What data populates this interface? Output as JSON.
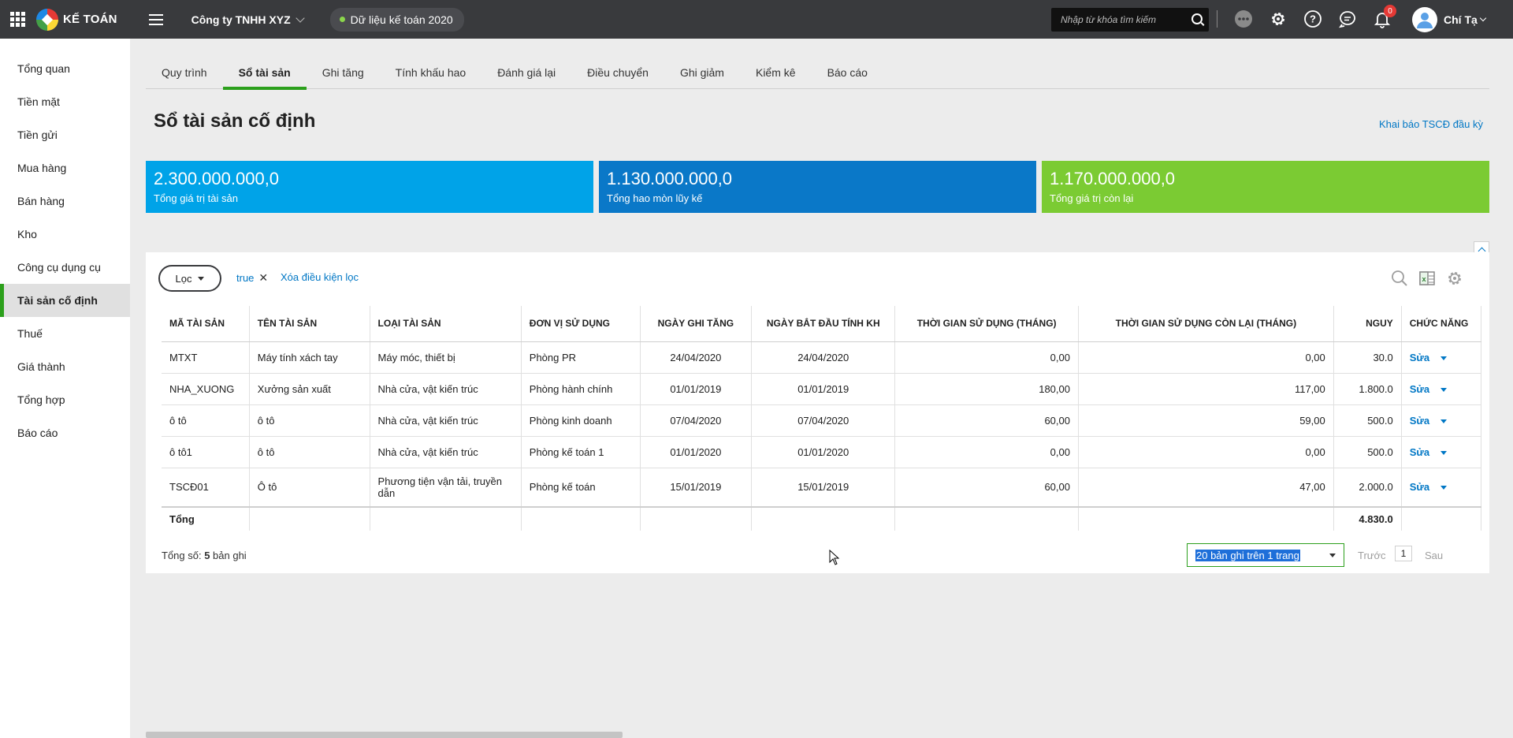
{
  "header": {
    "app_name": "KẾ TOÁN",
    "company": "Công ty TNHH XYZ",
    "dataset": "Dữ liệu kế toán 2020",
    "search_placeholder": "Nhập từ khóa tìm kiếm",
    "notification_count": "0",
    "user_name": "Chí Tạ"
  },
  "sidebar": {
    "items": [
      {
        "label": "Tổng quan"
      },
      {
        "label": "Tiền mặt"
      },
      {
        "label": "Tiền gửi"
      },
      {
        "label": "Mua hàng"
      },
      {
        "label": "Bán hàng"
      },
      {
        "label": "Kho"
      },
      {
        "label": "Công cụ dụng cụ"
      },
      {
        "label": "Tài sản cố định",
        "active": true
      },
      {
        "label": "Thuế"
      },
      {
        "label": "Giá thành"
      },
      {
        "label": "Tổng hợp"
      },
      {
        "label": "Báo cáo"
      }
    ]
  },
  "tabs": [
    "Quy trình",
    "Sổ tài sản",
    "Ghi tăng",
    "Tính khấu hao",
    "Đánh giá lại",
    "Điều chuyển",
    "Ghi giảm",
    "Kiểm kê",
    "Báo cáo"
  ],
  "active_tab": "Sổ tài sản",
  "page": {
    "title": "Sổ tài sản cố định",
    "declare_link": "Khai báo TSCĐ đầu kỳ"
  },
  "kpis": [
    {
      "value": "2.300.000.000,0",
      "label": "Tổng giá trị tài sản",
      "color": "#00a3e8"
    },
    {
      "value": "1.130.000.000,0",
      "label": "Tổng hao mòn lũy kế",
      "color": "#0a78c8"
    },
    {
      "value": "1.170.000.000,0",
      "label": "Tổng giá trị còn lại",
      "color": "#7bcb33"
    }
  ],
  "filter": {
    "button_label": "Lọc",
    "chip": "true",
    "clear_label": "Xóa điều kiện lọc"
  },
  "table": {
    "columns": [
      "MÃ TÀI SẢN",
      "TÊN TÀI SẢN",
      "LOẠI TÀI SẢN",
      "ĐƠN VỊ SỬ DỤNG",
      "NGÀY GHI TĂNG",
      "NGÀY BẮT ĐẦU TÍNH KH",
      "THỜI GIAN SỬ DỤNG (THÁNG)",
      "THỜI GIAN SỬ DỤNG CÒN LẠI (THÁNG)",
      "NGUY",
      "CHỨC NĂNG"
    ],
    "rows": [
      [
        "MTXT",
        "Máy tính xách tay",
        "Máy móc, thiết bị",
        "Phòng PR",
        "24/04/2020",
        "24/04/2020",
        "0,00",
        "0,00",
        "30.0"
      ],
      [
        "NHA_XUONG",
        "Xưởng sản xuất",
        "Nhà cửa, vật kiến trúc",
        "Phòng hành chính",
        "01/01/2019",
        "01/01/2019",
        "180,00",
        "117,00",
        "1.800.0"
      ],
      [
        "ô tô",
        "ô tô",
        "Nhà cửa, vật kiến trúc",
        "Phòng kinh doanh",
        "07/04/2020",
        "07/04/2020",
        "60,00",
        "59,00",
        "500.0"
      ],
      [
        "ô tô1",
        "ô tô",
        "Nhà cửa, vật kiến trúc",
        "Phòng kế toán  1",
        "01/01/2020",
        "01/01/2020",
        "0,00",
        "0,00",
        "500.0"
      ],
      [
        "TSCĐ01",
        "Ô tô",
        "Phương tiện vận tải, truyền dẫn",
        "Phòng kế toán",
        "15/01/2019",
        "15/01/2019",
        "60,00",
        "47,00",
        "2.000.0"
      ]
    ],
    "edit_label": "Sửa",
    "total_label": "Tổng",
    "total_value": "4.830.0"
  },
  "footer": {
    "total_prefix": "Tổng số: ",
    "total_count": "5",
    "total_suffix": " bản ghi",
    "page_size": "20 bản ghi trên 1 trang",
    "prev_label": "Trước",
    "page_number": "1",
    "next_label": "Sau"
  }
}
